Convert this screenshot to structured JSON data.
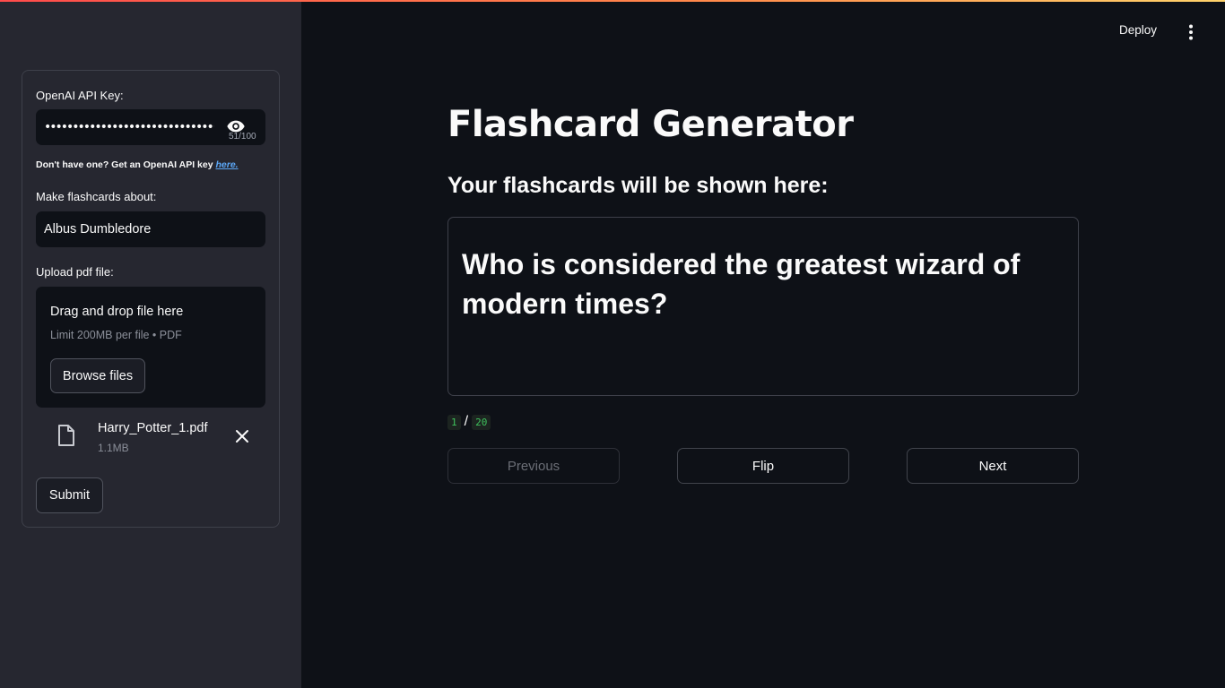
{
  "app": {
    "deploy_label": "Deploy",
    "title": "Flashcard Generator",
    "subheading": "Your flashcards will be shown here:"
  },
  "sidebar": {
    "api_key_label": "OpenAI API Key:",
    "api_key_value": "•••••••••••••••••••••••••••••••••••••••••••••••••••",
    "api_key_char_count": "51/100",
    "help_text": "Don't have one? Get an OpenAI API key ",
    "help_link": "here.",
    "topic_label": "Make flashcards about:",
    "topic_value": "Albus Dumbledore",
    "upload_label": "Upload pdf file:",
    "dropzone_title": "Drag and drop file here",
    "dropzone_limit": "Limit 200MB per file • PDF",
    "browse_label": "Browse files",
    "file_name": "Harry_Potter_1.pdf",
    "file_size": "1.1MB",
    "submit_label": "Submit"
  },
  "flashcard": {
    "question": "Who is considered the greatest wizard of modern times?",
    "current": "1",
    "separator": "/",
    "total": "20"
  },
  "nav": {
    "previous_label": "Previous",
    "flip_label": "Flip",
    "next_label": "Next"
  },
  "colors": {
    "background": "#0e1117",
    "sidebar": "#262730",
    "link": "#5ca8f7",
    "counter_text": "#3ec25c"
  }
}
